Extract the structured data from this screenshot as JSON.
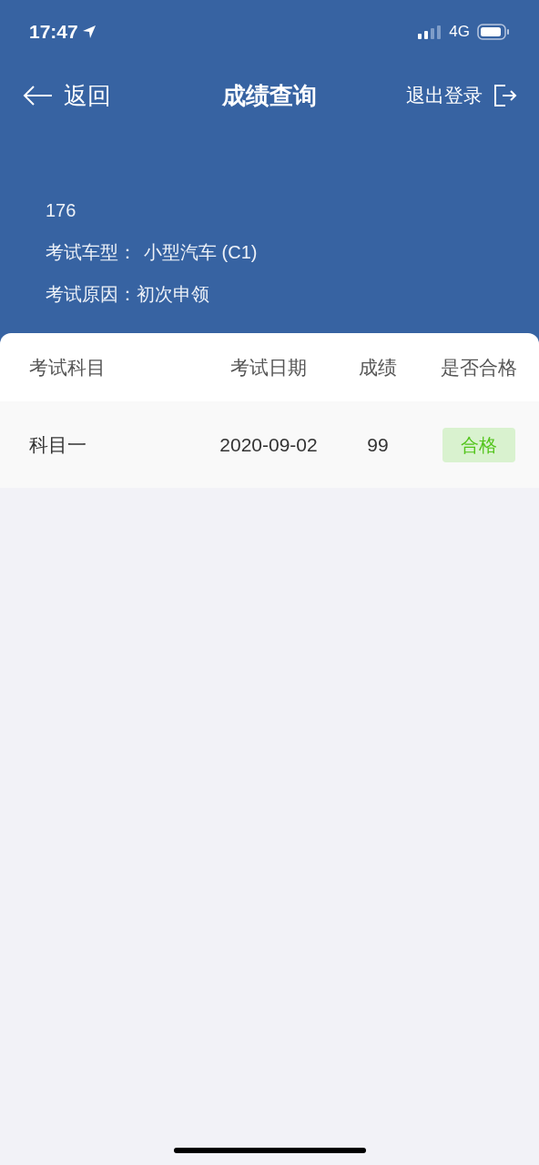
{
  "status_bar": {
    "time": "17:47",
    "network": "4G"
  },
  "nav": {
    "back": "返回",
    "title": "成绩查询",
    "logout": "退出登录"
  },
  "info": {
    "phone": "176",
    "vehicle_label": "考试车型：",
    "vehicle_value": "小型汽车 (C1)",
    "reason_label": "考试原因：",
    "reason_value": "初次申领"
  },
  "table": {
    "columns": [
      "考试科目",
      "考试日期",
      "成绩",
      "是否合格"
    ],
    "rows": [
      {
        "subject": "科目一",
        "date": "2020-09-02",
        "score": "99",
        "result": "合格",
        "passed": true
      }
    ]
  }
}
